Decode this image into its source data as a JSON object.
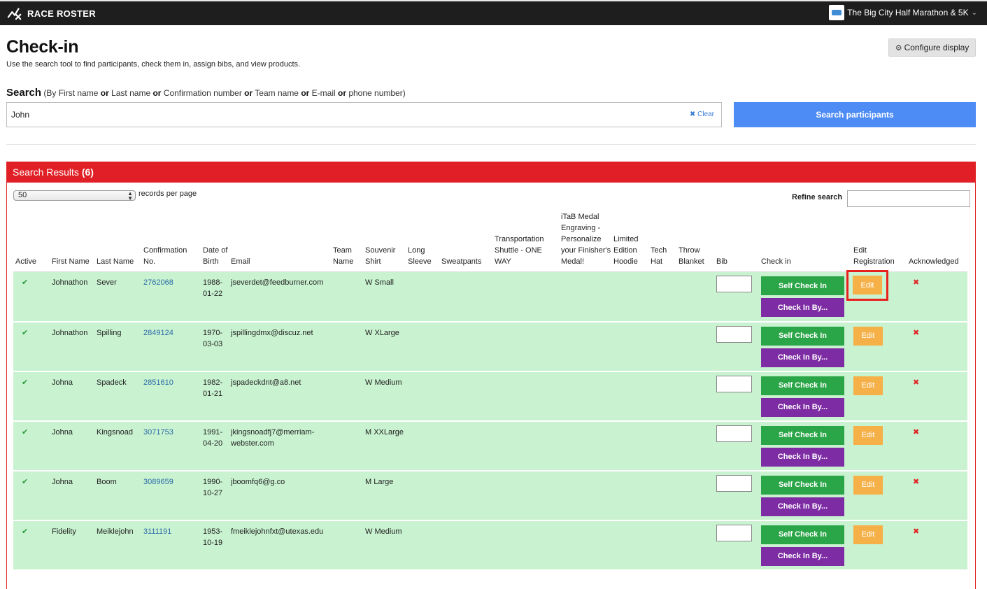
{
  "topbar": {
    "brand": "RACE ROSTER",
    "event_name": "The Big City Half Marathon & 5K"
  },
  "page": {
    "title": "Check-in",
    "subtitle": "Use the search tool to find participants, check them in, assign bibs, and view products.",
    "configure_label": "Configure display"
  },
  "search": {
    "label": "Search",
    "hint_open": "(By First name ",
    "or": "or",
    "hint_last": " Last name ",
    "hint_conf": " Confirmation number ",
    "hint_team": " Team name ",
    "hint_email": " E-mail ",
    "hint_phone": " phone number)",
    "value": "John",
    "clear_label": "Clear",
    "button_label": "Search participants"
  },
  "results": {
    "header_label": "Search Results",
    "count": "(6)",
    "per_page_value": "50",
    "per_page_label": "records per page",
    "refine_label": "Refine search",
    "columns": {
      "active": "Active",
      "first": "First Name",
      "last": "Last Name",
      "conf": "Confirmation No.",
      "dob": "Date of Birth",
      "email": "Email",
      "team": "Team Name",
      "shirt": "Souvenir Shirt",
      "sleeve": "Long Sleeve",
      "sweat": "Sweatpants",
      "shuttle": "Transportation Shuttle - ONE WAY",
      "medal": "iTaB Medal Engraving - Personalize your Finisher's Medal!",
      "hoodie": "Limited Edition Hoodie",
      "hat": "Tech Hat",
      "blanket": "Throw Blanket",
      "bib": "Bib",
      "checkin": "Check in",
      "edit": "Edit Registration",
      "ack": "Acknowledged"
    },
    "self_checkin_label": "Self Check In",
    "checkin_by_label": "Check In By...",
    "edit_label": "Edit",
    "rows": [
      {
        "first": "Johnathon",
        "last": "Sever",
        "conf": "2762068",
        "dob": "1988-01-22",
        "email": "jseverdet@feedburner.com",
        "shirt": "W Small"
      },
      {
        "first": "Johnathon",
        "last": "Spilling",
        "conf": "2849124",
        "dob": "1970-03-03",
        "email": "jspillingdmx@discuz.net",
        "shirt": "W XLarge"
      },
      {
        "first": "Johna",
        "last": "Spadeck",
        "conf": "2851610",
        "dob": "1982-01-21",
        "email": "jspadeckdnt@a8.net",
        "shirt": "W Medium"
      },
      {
        "first": "Johna",
        "last": "Kingsnoad",
        "conf": "3071753",
        "dob": "1991-04-20",
        "email": "jkingsnoadfj7@merriam-webster.com",
        "shirt": "M XXLarge"
      },
      {
        "first": "Johna",
        "last": "Boom",
        "conf": "3089659",
        "dob": "1990-10-27",
        "email": "jboomfq6@g.co",
        "shirt": "M Large"
      },
      {
        "first": "Fidelity",
        "last": "Meiklejohn",
        "conf": "3111191",
        "dob": "1953-10-19",
        "email": "fmeiklejohnfxt@utexas.edu",
        "shirt": "W Medium"
      }
    ]
  },
  "colors": {
    "accent_red": "#e01f26",
    "search_blue": "#4d8bf5",
    "row_green": "#c9f2d0",
    "checkin_green": "#2aa547",
    "checkin_by_purple": "#7d2ca3",
    "edit_orange": "#f6b048"
  }
}
